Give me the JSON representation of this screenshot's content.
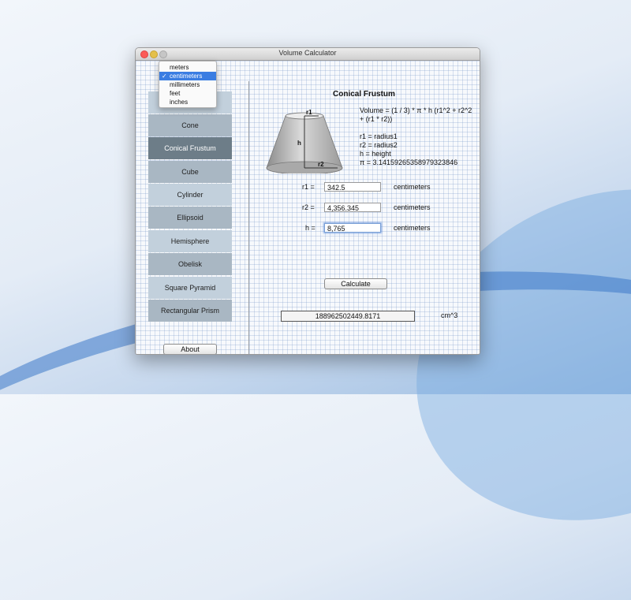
{
  "window": {
    "title": "Volume Calculator"
  },
  "units_menu": {
    "items": [
      "meters",
      "centimeters",
      "millimeters",
      "feet",
      "inches"
    ],
    "selected": "centimeters",
    "check": "✓"
  },
  "sidebar": {
    "items": [
      "Cone",
      "Conical Frustum",
      "Cube",
      "Cylinder",
      "Ellipsoid",
      "Hemisphere",
      "Obelisk",
      "Square Pyramid",
      "Rectangular Prism"
    ],
    "selected": "Conical Frustum",
    "about_label": "About"
  },
  "shape": {
    "title": "Conical Frustum",
    "formula": "Volume = (1 / 3) * π * h (r1^2 + r2^2 + (r1 * r2))",
    "definitions": [
      "r1 = radius1",
      "r2 = radius2",
      "h = height",
      "π = 3.14159265358979323846"
    ],
    "diagram_labels": {
      "r1": "r1",
      "r2": "r2",
      "h": "h"
    }
  },
  "inputs": [
    {
      "label": "r1 =",
      "value": "342.5",
      "unit": "centimeters"
    },
    {
      "label": "r2 =",
      "value": "4,356.345",
      "unit": "centimeters"
    },
    {
      "label": "h =",
      "value": "8,765",
      "unit": "centimeters"
    }
  ],
  "calculate_label": "Calculate",
  "result": {
    "value": "188962502449.8171",
    "unit": "cm^3"
  },
  "colors": {
    "nav_selected": "#6d7d88",
    "menu_highlight": "#3a7de2"
  }
}
